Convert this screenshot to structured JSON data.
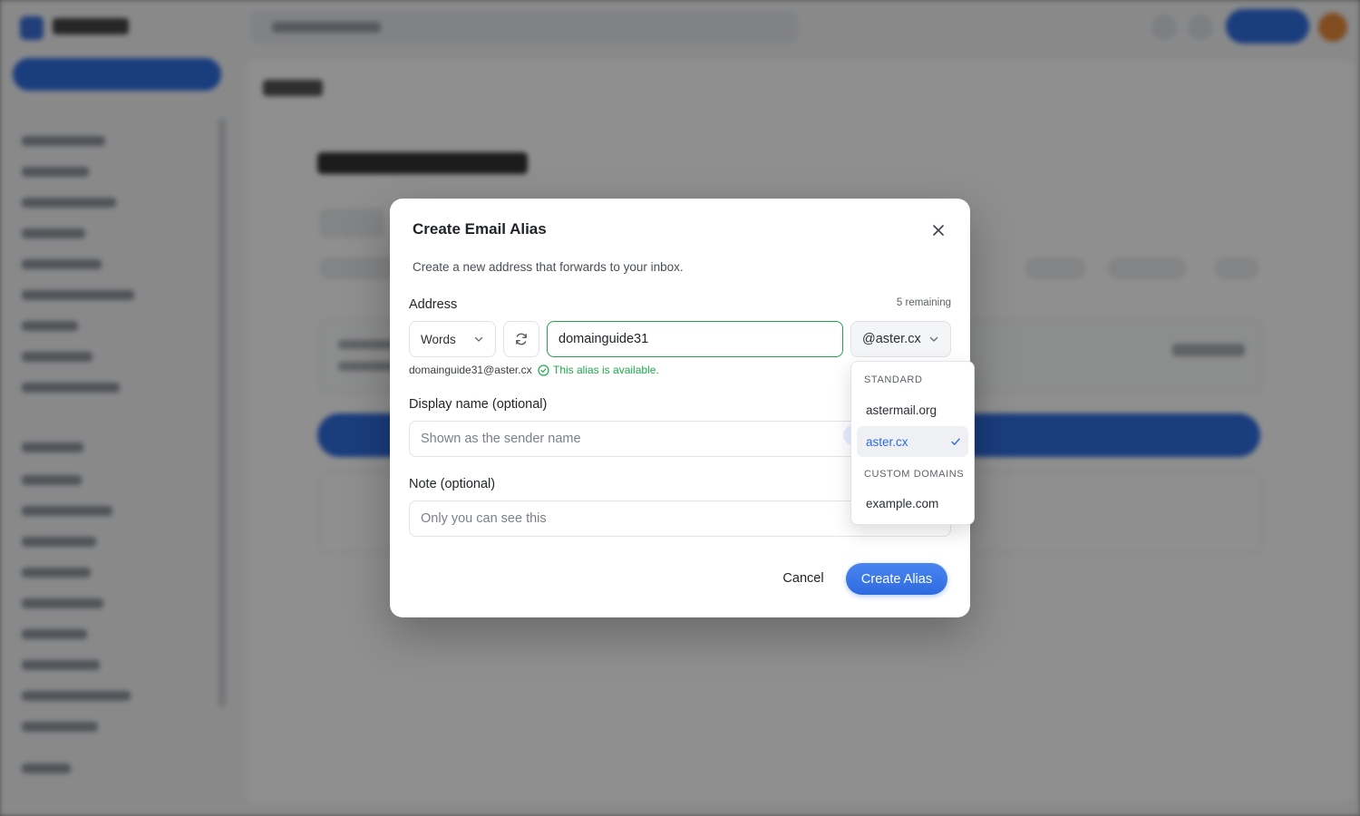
{
  "modal": {
    "title": "Create Email Alias",
    "description": "Create a new address that forwards to your inbox.",
    "address_label": "Address",
    "remaining": "5 remaining",
    "generator_value": "Words",
    "alias_value": "domainguide31",
    "domain_at": "@",
    "domain_value": "aster.cx",
    "preview_email": "domainguide31@aster.cx",
    "availability": "This alias is available.",
    "display_name_label": "Display name (optional)",
    "display_name_placeholder": "Shown as the sender name",
    "note_label": "Note (optional)",
    "note_placeholder": "Only you can see this",
    "cancel_label": "Cancel",
    "create_label": "Create Alias"
  },
  "domain_dropdown": {
    "groups": [
      {
        "label": "STANDARD",
        "items": [
          "astermail.org",
          "aster.cx"
        ]
      },
      {
        "label": "CUSTOM DOMAINS",
        "items": [
          "example.com"
        ]
      }
    ],
    "selected": "aster.cx"
  },
  "colors": {
    "accent": "#2e6ae0",
    "success": "#1eaa4c"
  }
}
